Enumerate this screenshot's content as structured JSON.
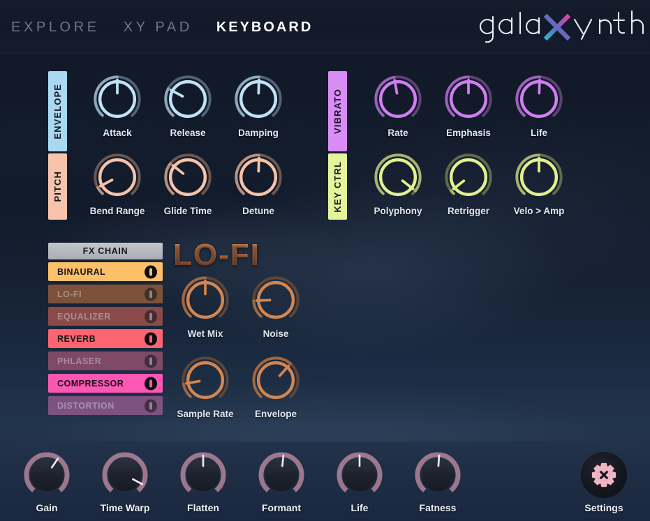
{
  "app": {
    "name": "galaXynth",
    "logo_text_before": "gala",
    "logo_x": "X",
    "logo_text_after": "ynth",
    "logo_gradient_start": "#3ec8d8",
    "logo_gradient_end": "#e040a0"
  },
  "nav": {
    "tabs": [
      {
        "label": "EXPLORE",
        "active": false
      },
      {
        "label": "XY PAD",
        "active": false
      },
      {
        "label": "KEYBOARD",
        "active": true
      }
    ]
  },
  "sections": [
    {
      "id": "envelope",
      "label": "ENVELOPE",
      "tab_color": "#a9d9f2",
      "knob_color": "#bfe2f5",
      "track_color": "#5d6e80",
      "knobs": [
        {
          "label": "Attack",
          "value_deg": 0
        },
        {
          "label": "Release",
          "value_deg": -62
        },
        {
          "label": "Damping",
          "value_deg": 2
        }
      ]
    },
    {
      "id": "pitch",
      "label": "PITCH",
      "tab_color": "#f7c4ab",
      "knob_color": "#f6c2a6",
      "track_color": "#7a6257",
      "knobs": [
        {
          "label": "Bend Range",
          "value_deg": -118
        },
        {
          "label": "Glide Time",
          "value_deg": -52
        },
        {
          "label": "Detune",
          "value_deg": 2
        }
      ]
    },
    {
      "id": "vibrato",
      "label": "VIBRATO",
      "tab_color": "#d98cf5",
      "knob_color": "#cf7ef0",
      "track_color": "#6a4a80",
      "knobs": [
        {
          "label": "Rate",
          "value_deg": -10
        },
        {
          "label": "Emphasis",
          "value_deg": 0
        },
        {
          "label": "Life",
          "value_deg": 2
        }
      ]
    },
    {
      "id": "keyctrl",
      "label": "KEY CTRL",
      "tab_color": "#e4f49a",
      "knob_color": "#e2f08e",
      "track_color": "#6f7750",
      "knobs": [
        {
          "label": "Polyphony",
          "value_deg": 128
        },
        {
          "label": "Retrigger",
          "value_deg": -128
        },
        {
          "label": "Velo > Amp",
          "value_deg": 0
        }
      ]
    }
  ],
  "fx_chain": {
    "header": "FX CHAIN",
    "rows": [
      {
        "label": "BINAURAL",
        "enabled": true,
        "color": "#fcc068"
      },
      {
        "label": "LO-FI",
        "enabled": false,
        "color": "#7d523a"
      },
      {
        "label": "EQUALIZER",
        "enabled": false,
        "color": "#8a4a4a"
      },
      {
        "label": "REVERB",
        "enabled": true,
        "color": "#fc6470"
      },
      {
        "label": "PHLASER",
        "enabled": false,
        "color": "#7e4a66"
      },
      {
        "label": "COMPRESSOR",
        "enabled": true,
        "color": "#fc57b4"
      },
      {
        "label": "DISTORTION",
        "enabled": false,
        "color": "#7d5280"
      }
    ]
  },
  "lofi_panel": {
    "title": "LO-FI",
    "knob_color": "#d4854f",
    "track_color": "#6a4a36",
    "knobs": [
      {
        "label": "Wet Mix",
        "value_deg": 0
      },
      {
        "label": "Noise",
        "value_deg": -92
      },
      {
        "label": "Sample Rate",
        "value_deg": -100
      },
      {
        "label": "Envelope",
        "value_deg": 42
      }
    ]
  },
  "master": {
    "knob_color": "#f2a8bc",
    "knobs": [
      {
        "label": "Gain",
        "value_deg": 34
      },
      {
        "label": "Time Warp",
        "value_deg": 118
      },
      {
        "label": "Flatten",
        "value_deg": 0
      },
      {
        "label": "Formant",
        "value_deg": 6
      },
      {
        "label": "Life",
        "value_deg": 0
      },
      {
        "label": "Fatness",
        "value_deg": 4
      }
    ],
    "settings_label": "Settings",
    "settings_icon": "gear-x-icon",
    "settings_color": "#f0b6c6"
  }
}
